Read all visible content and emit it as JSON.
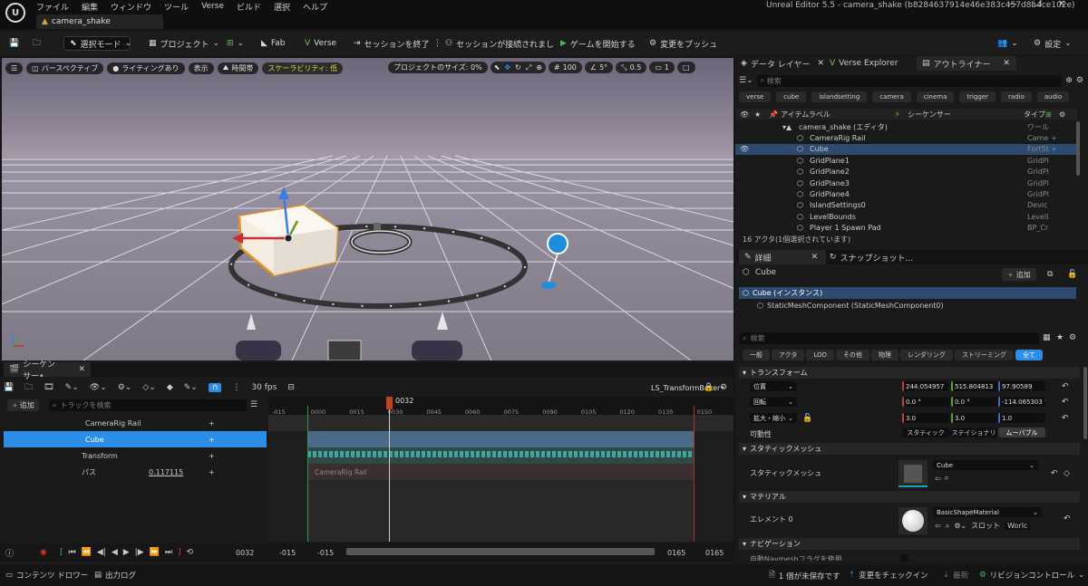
{
  "menu": [
    "ファイル",
    "編集",
    "ウィンドウ",
    "ツール",
    "Verse",
    "ビルド",
    "選択",
    "ヘルプ"
  ],
  "window_title": "Unreal Editor 5.5 - camera_shake (b8284637914e46e383c457d8b4ce102e)",
  "doc_tab": "camera_shake",
  "toolbar": {
    "select_mode": "選択モード",
    "project": "プロジェクト",
    "fab": "Fab",
    "verse": "Verse",
    "end_session": "セッションを終了",
    "session_connected": "セッションが接続されまし",
    "start_game": "ゲームを開始する",
    "push_changes": "変更をプッシュ",
    "settings": "設定"
  },
  "viewport": {
    "perspective": "パースペクティブ",
    "lighting": "ライティングあり",
    "show": "表示",
    "time": "時間帯",
    "scalability": "スケーラビリティ: 低",
    "project_size_label": "プロジェクトのサイズ: 0%",
    "grid_size": "100",
    "rotation_snap": "5°",
    "scale_snap": "0.5",
    "camera_speed": "1"
  },
  "outliner": {
    "tabs": [
      "データ レイヤー",
      "Verse Explorer",
      "アウトライナー"
    ],
    "search_placeholder": "検索",
    "filters": [
      "verse",
      "cube",
      "islandsetting",
      "camera",
      "cinema",
      "trigger",
      "radio",
      "audio"
    ],
    "col_label": "アイテムラベル",
    "col_sequencer": "シーケンサー",
    "col_type": "タイプ",
    "items": [
      {
        "name": "camera_shake (エディタ)",
        "type": "ワール",
        "level": 0
      },
      {
        "name": "CameraRig Rail",
        "type": "Came",
        "level": 1
      },
      {
        "name": "Cube",
        "type": "FortSt",
        "level": 1
      },
      {
        "name": "GridPlane1",
        "type": "GridPl",
        "level": 1
      },
      {
        "name": "GridPlane2",
        "type": "GridPl",
        "level": 1
      },
      {
        "name": "GridPlane3",
        "type": "GridPl",
        "level": 1
      },
      {
        "name": "GridPlane4",
        "type": "GridPl",
        "level": 1
      },
      {
        "name": "IslandSettings0",
        "type": "Devic",
        "level": 1
      },
      {
        "name": "LevelBounds",
        "type": "LevelI",
        "level": 1
      },
      {
        "name": "Player 1 Spawn Pad",
        "type": "BP_Cr",
        "level": 1
      }
    ],
    "status": "16 アクタ(1個選択されています)"
  },
  "details": {
    "tab": "詳細",
    "tab2": "スナップショット...",
    "object": "Cube",
    "add": "追加",
    "instance": "Cube (インスタンス)",
    "component": "StaticMeshComponent (StaticMeshComponent0)",
    "search_placeholder": "検索",
    "cat_tabs": [
      "一般",
      "アクタ",
      "LOD",
      "その他",
      "物理",
      "レンダリング",
      "ストリーミング",
      "全て"
    ],
    "transform_header": "トランスフォーム",
    "location_label": "位置",
    "location": [
      "244.054957",
      "515.804813",
      "97.90589"
    ],
    "rotation_label": "回転",
    "rotation": [
      "0.0 °",
      "0.0 °",
      "-114.065303 °"
    ],
    "scale_label": "拡大・縮小",
    "scale": [
      "3.0",
      "3.0",
      "1.0"
    ],
    "mobility_label": "可動性",
    "mobility": [
      "スタティック",
      "ステイショナリ",
      "ムーバブル"
    ],
    "static_mesh_header": "スタティックメッシュ",
    "static_mesh_label": "スタティックメッシュ",
    "static_mesh_value": "Cube",
    "material_header": "マテリアル",
    "element_label": "エレメント 0",
    "material_value": "BasicShapeMaterial",
    "slot_label": "スロット",
    "slot_value": "Worlc",
    "navigation_header": "ナビゲーション",
    "navmesh_label": "自動Navmeshフラグを使用"
  },
  "sequencer": {
    "tab": "シーケンサー•",
    "fps": "30 fps",
    "sequence_name": "LS_TransformBaker•",
    "add": "追加",
    "search_placeholder": "トラックを検索",
    "tracks": [
      {
        "name": "CameraRig Rail",
        "value": ""
      },
      {
        "name": "Cube",
        "value": ""
      },
      {
        "name": "Transform",
        "value": ""
      },
      {
        "name": "パス",
        "value": "0.117115"
      }
    ],
    "ticks": [
      "-015",
      "0000",
      "0015",
      "0030",
      "0045",
      "0060",
      "0075",
      "0090",
      "0105",
      "0120",
      "0135",
      "0150"
    ],
    "playhead": "0032",
    "current_frame": "0032",
    "range_start": "-015",
    "range_start2": "-015",
    "range_end": "0165",
    "range_end2": "0165",
    "path_track_label": "CameraRig Rail"
  },
  "statusbar": {
    "content_drawer": "コンテンツ ドロワー",
    "output_log": "出力ログ",
    "unsaved": "1 個が未保存です",
    "check_in": "変更をチェックイン",
    "latest": "最新",
    "revision": "リビジョンコントロール"
  },
  "colors": {
    "accent": "#0070e0",
    "selection": "#2e4a6e",
    "play": "#3db85b",
    "record": "#e03030",
    "add": "#5cb85c"
  }
}
